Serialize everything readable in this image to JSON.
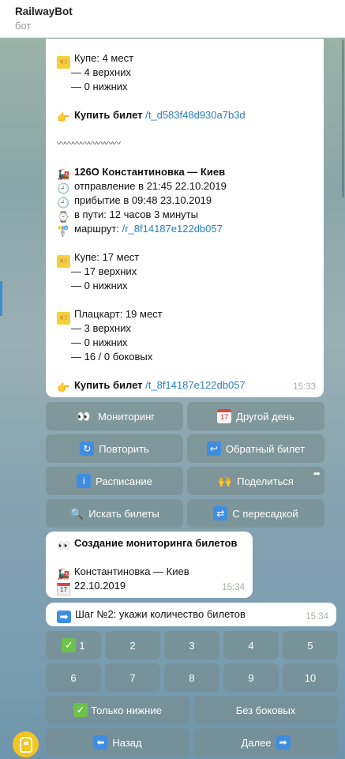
{
  "header": {
    "title": "RailwayBot",
    "subtitle": "бот"
  },
  "message1": {
    "lines": {
      "kupe1": "Купе: 4 мест",
      "kupe1_upper": "— 4 верхних",
      "kupe1_lower": "— 0 нижних",
      "buy1_label": "Купить билет",
      "buy1_link": "/t_d583f48d930a7b3d",
      "separator": "〰〰〰〰〰〰〰〰",
      "train_title": "126О Константиновка — Киев",
      "departure": "отправление в 21:45 22.10.2019",
      "arrival": "прибытие в 09:48 23.10.2019",
      "duration": "в пути: 12 часов 3 минуты",
      "route_label": "маршрут:",
      "route_link": "/r_8f14187e122db057",
      "kupe2": "Купе: 17 мест",
      "kupe2_upper": "— 17 верхних",
      "kupe2_lower": "— 0 нижних",
      "platz": "Плацкарт: 19 мест",
      "platz_upper": "— 3 верхних",
      "platz_lower": "— 0 нижних",
      "platz_side": "— 16 / 0 боковых",
      "buy2_label": "Купить билет",
      "buy2_link": "/t_8f14187e122db057"
    },
    "time": "15:33"
  },
  "keyboard1": {
    "monitoring": "Мониторинг",
    "other_day": "Другой день",
    "repeat": "Повторить",
    "return_ticket": "Обратный билет",
    "schedule": "Расписание",
    "share": "Поделиться",
    "search_tickets": "Искать билеты",
    "with_transfer": "С пересадкой",
    "calendar_day": "17"
  },
  "message2": {
    "title": "Создание мониторинга билетов",
    "route": "Константиновка — Киев",
    "date": "22.10.2019",
    "time": "15:34",
    "calendar_day": "17"
  },
  "message3": {
    "text": "Шаг №2: укажи количество билетов",
    "time": "15:34"
  },
  "keyboard2": {
    "numbers": [
      "1",
      "2",
      "3",
      "4",
      "5",
      "6",
      "7",
      "8",
      "9",
      "10"
    ],
    "only_lower": "Только нижние",
    "no_side": "Без боковых",
    "back": "Назад",
    "next": "Далее"
  },
  "icons": {
    "ticket": "ticket-icon",
    "hand": "pointing-hand-icon",
    "train": "locomotive-icon",
    "clock": "clock-icon",
    "watch": "watch-icon",
    "route": "route-sign-icon",
    "eyes": "eyes-icon",
    "calendar": "calendar-icon",
    "repeat": "repeat-icon",
    "return": "return-arrow-icon",
    "info": "info-icon",
    "raised_hands": "raised-hands-icon",
    "magnifier": "magnifier-icon",
    "shuffle": "shuffle-icon",
    "right_arrow": "right-arrow-icon",
    "left_arrow": "left-arrow-icon",
    "check": "check-mark-icon"
  },
  "colors": {
    "link": "#2a7fbf",
    "keyboard_button": "#7a8c8c",
    "check_green": "#6cc24a",
    "avatar": "#f3c623"
  }
}
